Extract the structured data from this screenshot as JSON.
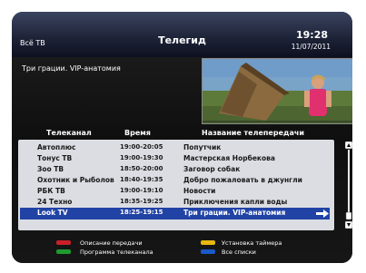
{
  "header": {
    "left_label": "Всё ТВ",
    "title": "Телегид",
    "time": "19:28",
    "date": "11/07/2011"
  },
  "description": {
    "title": "Три грации. VIP-анатомия"
  },
  "columns": {
    "channel": "Телеканал",
    "time": "Время",
    "program": "Название телепередачи"
  },
  "rows": [
    {
      "channel": "Автоплюс",
      "time": "19:00-20:05",
      "program": "Попутчик",
      "selected": false
    },
    {
      "channel": "Тонус ТВ",
      "time": "19:00-19:30",
      "program": "Мастерская Норбекова",
      "selected": false
    },
    {
      "channel": "Зоо ТВ",
      "time": "18:50-20:00",
      "program": "Заговор собак",
      "selected": false
    },
    {
      "channel": "Охотник и Рыболов",
      "time": "18:40-19:35",
      "program": "Добро пожаловать в джунгли",
      "selected": false
    },
    {
      "channel": "РБК ТВ",
      "time": "19:00-19:10",
      "program": "Новости",
      "selected": false
    },
    {
      "channel": "24 Техно",
      "time": "18:35-19:25",
      "program": "Приключения капли воды",
      "selected": false
    },
    {
      "channel": "Look TV",
      "time": "18:25-19:15",
      "program": "Три грации. VIP-анатомия",
      "selected": true
    }
  ],
  "legend": {
    "red": "Описание передачи",
    "green": "Программа телеканала",
    "yellow": "Установка таймера",
    "blue": "Все списки"
  },
  "colors": {
    "red_key": "#c8202a",
    "green_key": "#1f9a2e",
    "yellow_key": "#e8b810",
    "blue_key": "#1b58c8",
    "selection": "#2143a6"
  }
}
